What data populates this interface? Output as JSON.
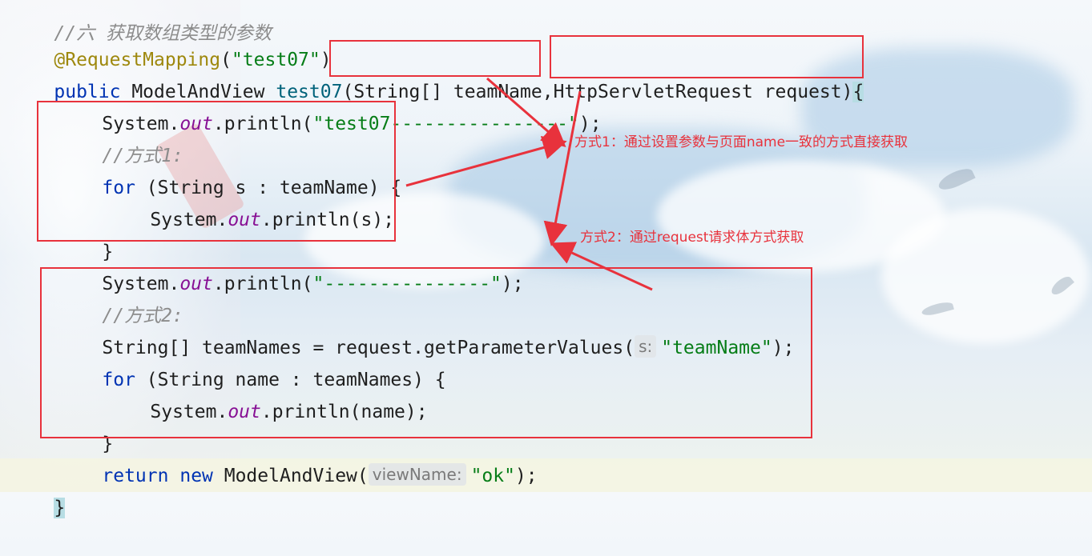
{
  "code": {
    "comment_top": "//六 获取数组类型的参数",
    "annotation": "@RequestMapping",
    "annotation_arg": "\"test07\"",
    "sig_public": "public",
    "sig_return": " ModelAndView ",
    "sig_method": "test07",
    "sig_param1": "String[] teamName",
    "sig_param2": "HttpServletRequest request",
    "print1_prefix": "System.",
    "out": "out",
    "print1_mid": ".println(",
    "print1_str": "\"test07----------------\"",
    "print1_end": ");",
    "comment1": "//方式1:",
    "for_kw": "for",
    "for1_rest": " (String s : teamName) {",
    "print_s": ".println(s);",
    "close_brace": "}",
    "print2_str": "\"---------------\"",
    "comment2": "//方式2:",
    "arr_decl": "String[] teamNames = request.getParameterValues(",
    "hint_s": "s:",
    "arr_str": "\"teamName\"",
    "for2_rest": " (String name : teamNames) {",
    "print_name": ".println(name);",
    "return_kw": "return",
    "new_kw": "new",
    "return_call": " ModelAndView(",
    "hint_view": "viewName:",
    "return_str": "\"ok\"",
    "final_brace": "}"
  },
  "annotations": {
    "note1": "方式1：通过设置参数与页面name一致的方式直接获取",
    "note2": "方式2：通过request请求体方式获取"
  },
  "colors": {
    "keyword": "#0033b3",
    "annotation": "#9e880d",
    "string": "#067d17",
    "static_field": "#871094",
    "comment": "#8c8c8c",
    "callout_red": "#e8323c"
  }
}
